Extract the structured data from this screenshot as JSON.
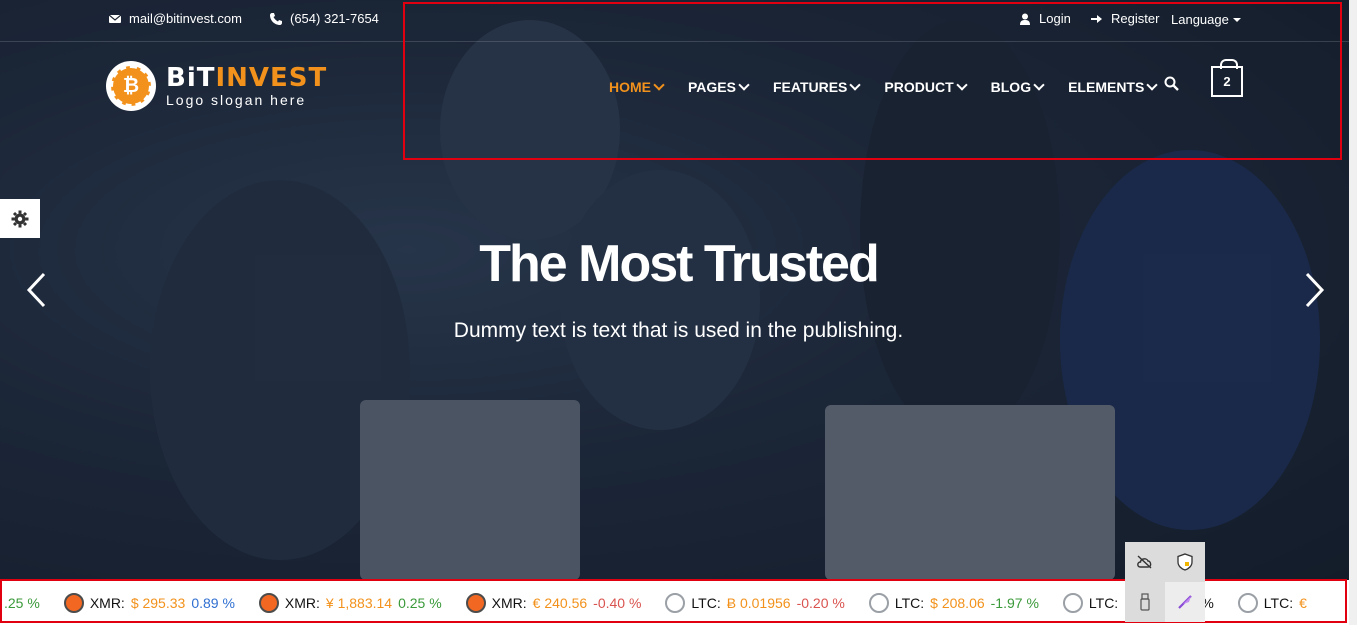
{
  "topbar": {
    "email": "mail@bitinvest.com",
    "phone": "(654) 321-7654",
    "login": "Login",
    "register": "Register",
    "language": "Language"
  },
  "logo": {
    "name_part1": "BiT",
    "name_part2": "INVEST",
    "slogan": "Logo slogan here",
    "coin_glyph": "₿"
  },
  "nav": {
    "items": [
      {
        "label": "HOME"
      },
      {
        "label": "PAGES"
      },
      {
        "label": "FEATURES"
      },
      {
        "label": "PRODUCT"
      },
      {
        "label": "BLOG"
      },
      {
        "label": "ELEMENTS"
      }
    ]
  },
  "cart": {
    "count": "2"
  },
  "hero": {
    "title": "The Most Trusted",
    "subtitle": "Dummy text is text that is used in the publishing."
  },
  "ticker": {
    "lead_change": ".25 %",
    "items": [
      {
        "symbol": "XMR:",
        "price": "$ 295.33",
        "change": "0.89 %",
        "icon": "monero-icon"
      },
      {
        "symbol": "XMR:",
        "price": "¥ 1,883.14",
        "change": "0.25 %",
        "icon": "monero-icon"
      },
      {
        "symbol": "XMR:",
        "price": "€ 240.56",
        "change": "-0.40 %",
        "icon": "monero-icon"
      },
      {
        "symbol": "LTC:",
        "price": "Ƀ 0.01956",
        "change": "-0.20 %",
        "icon": "litecoin-icon"
      },
      {
        "symbol": "LTC:",
        "price": "$ 208.06",
        "change": "-1.97 %",
        "icon": "litecoin-icon"
      },
      {
        "symbol": "LTC:",
        "price": "",
        "change": "0.20 %",
        "icon": "litecoin-icon"
      },
      {
        "symbol": "LTC:",
        "price": "€",
        "change": "",
        "icon": "litecoin-icon"
      }
    ]
  },
  "colors": {
    "accent": "#f2921c",
    "highlight_box": "#e00010"
  }
}
